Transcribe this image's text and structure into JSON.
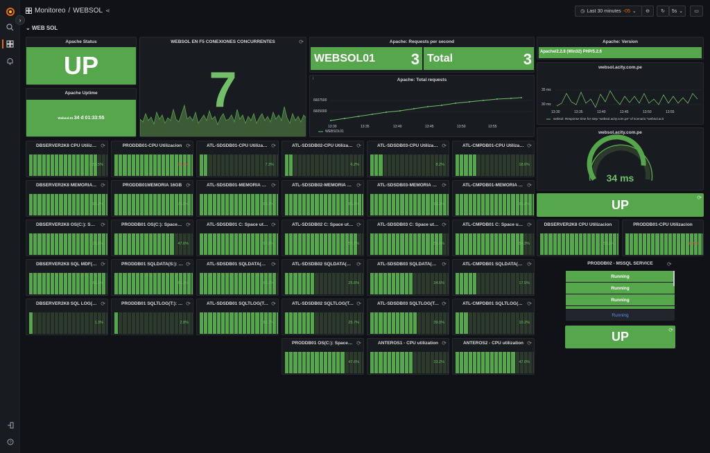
{
  "header": {
    "folder": "Monitoreo",
    "separator": "/",
    "dashboard": "WEBSOL",
    "time_range": "Last 30 minutes",
    "time_shift": "-05",
    "refresh": "5s"
  },
  "row_title": "WEB SOL",
  "apache_status": {
    "title": "Apache Status",
    "value": "UP"
  },
  "apache_uptime": {
    "title": "Apache Uptime",
    "host": "Websol.01",
    "value": "34 d 01:33:55"
  },
  "f5": {
    "title": "WEBSOL EN F5 CONEXIONES CONCURRENTES",
    "value": "7"
  },
  "rps": {
    "title": "Apache: Requests per second",
    "cells": [
      {
        "label": "WEBSOL01",
        "value": "3"
      },
      {
        "label": "Total",
        "value": "3"
      }
    ]
  },
  "total_req": {
    "title": "Apache: Total requests",
    "info": "i",
    "y_ticks": [
      "6607500",
      "6605000"
    ],
    "x_ticks": [
      "13:30",
      "13:35",
      "13:40",
      "13:45",
      "13:50",
      "13:55"
    ],
    "legend": "WEBSOL01"
  },
  "version": {
    "title": "Apache: Version",
    "value": "Apache/2.2.8 (Win32) PHP/5.2.6"
  },
  "resp": {
    "title": "websol.acity.com.pe",
    "y_ticks": [
      "35 ms",
      "30 ms"
    ],
    "x_ticks": [
      "13:30",
      "13:35",
      "13:40",
      "13:45",
      "13:50",
      "13:55"
    ],
    "legend": "websol: Response time for step \"websol.acity.com.pe\" of scenario \"websol.acit"
  },
  "gauge": {
    "title": "websol.acity.com.pe",
    "value": "34 ms",
    "level": 0.7
  },
  "up2": {
    "value": "UP"
  },
  "right_cpu": [
    {
      "title": "DBSERVER2K8 CPU Utilizacion",
      "pct": "53.5%",
      "bad": false,
      "on": 22
    },
    {
      "title": "PRODDB01-CPU Utilizacion",
      "pct": "90.9%",
      "bad": true,
      "on": 26
    }
  ],
  "mssql": {
    "title": "PRODDB02 - MSSQL SERVICE",
    "items": [
      "Running",
      "Running",
      "Running",
      "Running"
    ]
  },
  "up3": {
    "value": "UP"
  },
  "grid": [
    [
      {
        "t": "DBSERVER2K8 CPU Utilizacion",
        "p": "53.5%",
        "on": 16
      },
      {
        "t": "PRODDB01-CPU Utilizacion",
        "p": "90.9%",
        "on": 26,
        "bad": true
      },
      {
        "t": "ATL-SDSDB01-CPU Utilizacion",
        "p": "7.3%",
        "on": 2
      },
      {
        "t": "ATL-SDSDB02-CPU Utilizacion",
        "p": "6.2%",
        "on": 2
      },
      {
        "t": "ATL-SDSDB03-CPU Utilizacion",
        "p": "8.2%",
        "on": 3
      },
      {
        "t": "ATL-CMPDB01-CPU Utilizacion",
        "p": "18.6%",
        "on": 5
      }
    ],
    [
      {
        "t": "DBSERVER2K8 MEMORIA 32...",
        "p": "85.2%",
        "on": 25
      },
      {
        "t": "PRODDB01MEMORIA 16GB",
        "p": "79.5%",
        "on": 23
      },
      {
        "t": "ATL-SDSDB01-MEMORIA 16GB",
        "p": "83.7%",
        "on": 24
      },
      {
        "t": "ATL-SDSDB02-MEMORIA 16GB",
        "p": "85.0%",
        "on": 25
      },
      {
        "t": "ATL-SDSDB03-MEMORIA 16GB",
        "p": "82.3%",
        "on": 24
      },
      {
        "t": "ATL-CMPDB01-MEMORIA 16...",
        "p": "85.8%",
        "on": 25
      }
    ],
    [
      {
        "t": "DBSERVER2K8 OS(C:): Space...",
        "p": "78.6%",
        "on": 23
      },
      {
        "t": "PRODDB01 OS(C:): Space utili...",
        "p": "47.6%",
        "on": 14
      },
      {
        "t": "ATL-SDSDB01 C: Space utiliz...",
        "p": "67.0%",
        "on": 20
      },
      {
        "t": "ATL-SDSDB02 C: Space utiliz...",
        "p": "57.7%",
        "on": 17
      },
      {
        "t": "ATL-SDSDB03 C: Space utiliz...",
        "p": "59.6%",
        "on": 17
      },
      {
        "t": "ATL-CMPDB01 C: Space utiliz...",
        "p": "54.3%",
        "on": 16
      }
    ],
    [
      {
        "t": "DBSERVER2K8 SQL MDF(D:)...",
        "p": "62.5%",
        "on": 18
      },
      {
        "t": "PRODDB01 SQLDATA(S:): Sp...",
        "p": "81.3%",
        "on": 24
      },
      {
        "t": "ATL-SDSDB01 SQLDATA(S:)...",
        "p": "62.2%",
        "on": 18
      },
      {
        "t": "ATL-SDSDB02 SQLDATA(S:)...",
        "p": "25.6%",
        "on": 7
      },
      {
        "t": "ATL-SDSDB03 SQLDATA(S:)...",
        "p": "34.6%",
        "on": 10
      },
      {
        "t": "ATL-CMPDB01 SQLDATA(S:)...",
        "p": "17.5%",
        "on": 5
      }
    ],
    [
      {
        "t": "DBSERVER2K8 SQL LOG(E):...",
        "p": "1.3%",
        "on": 1
      },
      {
        "t": "PRODDB01 SQLTLOG(T:): Sp...",
        "p": "2.8%",
        "on": 1
      },
      {
        "t": "ATL-SDSDB01 SQLTLOG(T:)...",
        "p": "82.7%",
        "on": 24
      },
      {
        "t": "ATL-SDSDB02 SQLTLOG(T:)...",
        "p": "25.7%",
        "on": 7
      },
      {
        "t": "ATL-SDSDB03 SQLTLOG(T:)...",
        "p": "39.0%",
        "on": 11
      },
      {
        "t": "ATL-CMPDB01 SQLTLOG(T:)...",
        "p": "10.2%",
        "on": 3
      }
    ],
    [
      null,
      null,
      null,
      {
        "t": "PRODDB01 OS(C:): Space utili...",
        "p": "47.6%",
        "on": 14
      },
      {
        "t": "ANTEROS1 - CPU utilization",
        "p": "33.2%",
        "on": 10
      },
      {
        "t": "ANTEROS2 - CPU utilization",
        "p": "47.0%",
        "on": 14
      }
    ]
  ]
}
